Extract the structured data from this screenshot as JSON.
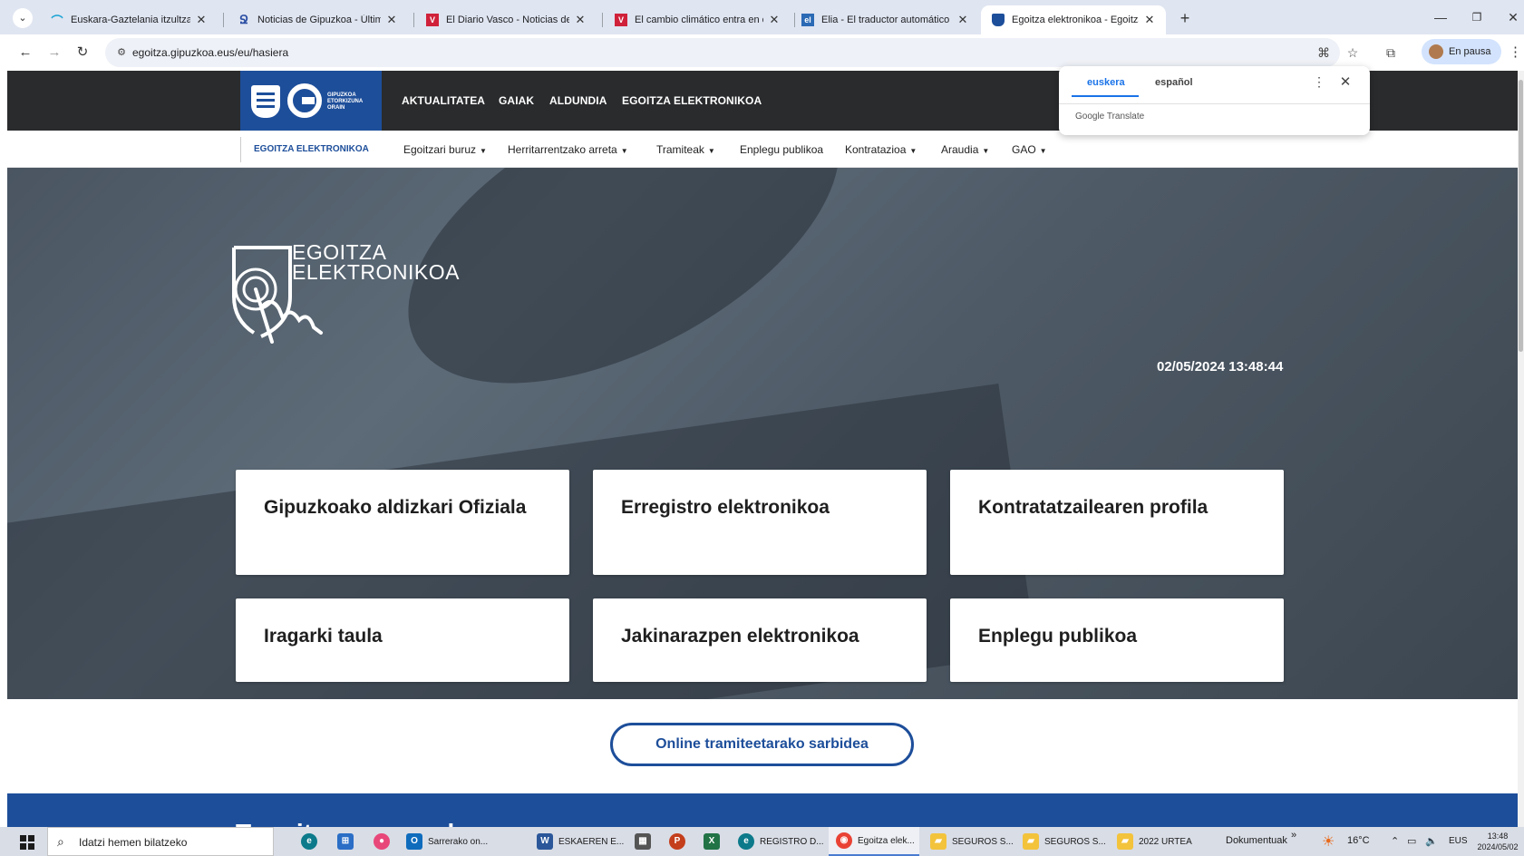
{
  "browser": {
    "tabs": [
      {
        "title": "Euskara-Gaztelania itzultzaile a",
        "favicon_color": "#1aa3d4",
        "active": false
      },
      {
        "title": "Noticias de Gipuzkoa - Última h",
        "favicon_color": "#2b4ea3",
        "active": false
      },
      {
        "title": "El Diario Vasco - Noticias de Do",
        "favicon_color": "#d0213a",
        "active": false
      },
      {
        "title": "El cambio climático entra en el",
        "favicon_color": "#d0213a",
        "active": false
      },
      {
        "title": "Elia - El traductor automático d",
        "favicon_color": "#2b6ab5",
        "active": false
      },
      {
        "title": "Egoitza elektronikoa - Egoitza e",
        "favicon_color": "#1d4e9a",
        "active": true
      }
    ],
    "url": "egoitza.gipuzkoa.eus/eu/hasiera",
    "profile_label": "En pausa"
  },
  "translate_popup": {
    "lang_source": "euskera",
    "lang_target": "español",
    "brand": "Google Translate"
  },
  "site": {
    "logo_text": "GIPUZKOA ETORKIZUNA ORAIN",
    "top_nav": [
      "AKTUALITATEA",
      "GAIAK",
      "ALDUNDIA",
      "EGOITZA ELEKTRONIKOA"
    ],
    "sub_nav_active": "EGOITZA ELEKTRONIKOA",
    "sub_nav": [
      {
        "label": "Egoitzari buruz",
        "has_menu": true
      },
      {
        "label": "Herritarrentzako arreta",
        "has_menu": true
      },
      {
        "label": "Tramiteak",
        "has_menu": true
      },
      {
        "label": "Enplegu publikoa",
        "has_menu": false
      },
      {
        "label": "Kontratazioa",
        "has_menu": true
      },
      {
        "label": "Araudia",
        "has_menu": true
      },
      {
        "label": "GAO",
        "has_menu": true
      }
    ],
    "hero_title_line1": "EGOITZA",
    "hero_title_line2": "ELEKTRONIKOA",
    "datetime": "02/05/2024 13:48:44",
    "cards": [
      "Gipuzkoako aldizkari Ofiziala",
      "Erregistro elektronikoa",
      "Kontratatzailearen profila",
      "Iragarki taula",
      "Jakinarazpen elektronikoa",
      "Enplegu publikoa"
    ],
    "cta_label": "Online tramiteetarako sarbidea",
    "next_section_title": "Tramiteen zerrenda"
  },
  "taskbar": {
    "search_placeholder": "Idatzi hemen bilatzeko",
    "apps": [
      {
        "label": "Sarrerako on...",
        "color": "#0f6cbd"
      },
      {
        "label": "ESKAEREN E...",
        "color": "#2b579a"
      },
      {
        "label": "REGISTRO D...",
        "color": "#0c7a8a"
      },
      {
        "label": "Egoitza elek...",
        "color": "#e94235"
      },
      {
        "label": "SEGUROS S...",
        "color": "#f3c33c"
      },
      {
        "label": "SEGUROS S...",
        "color": "#f3c33c"
      },
      {
        "label": "2022 URTEA",
        "color": "#f3c33c"
      }
    ],
    "toolbar_label": "Dokumentuak",
    "weather": "16°C",
    "lang": "EUS",
    "time": "13:48",
    "date": "2024/05/02"
  }
}
